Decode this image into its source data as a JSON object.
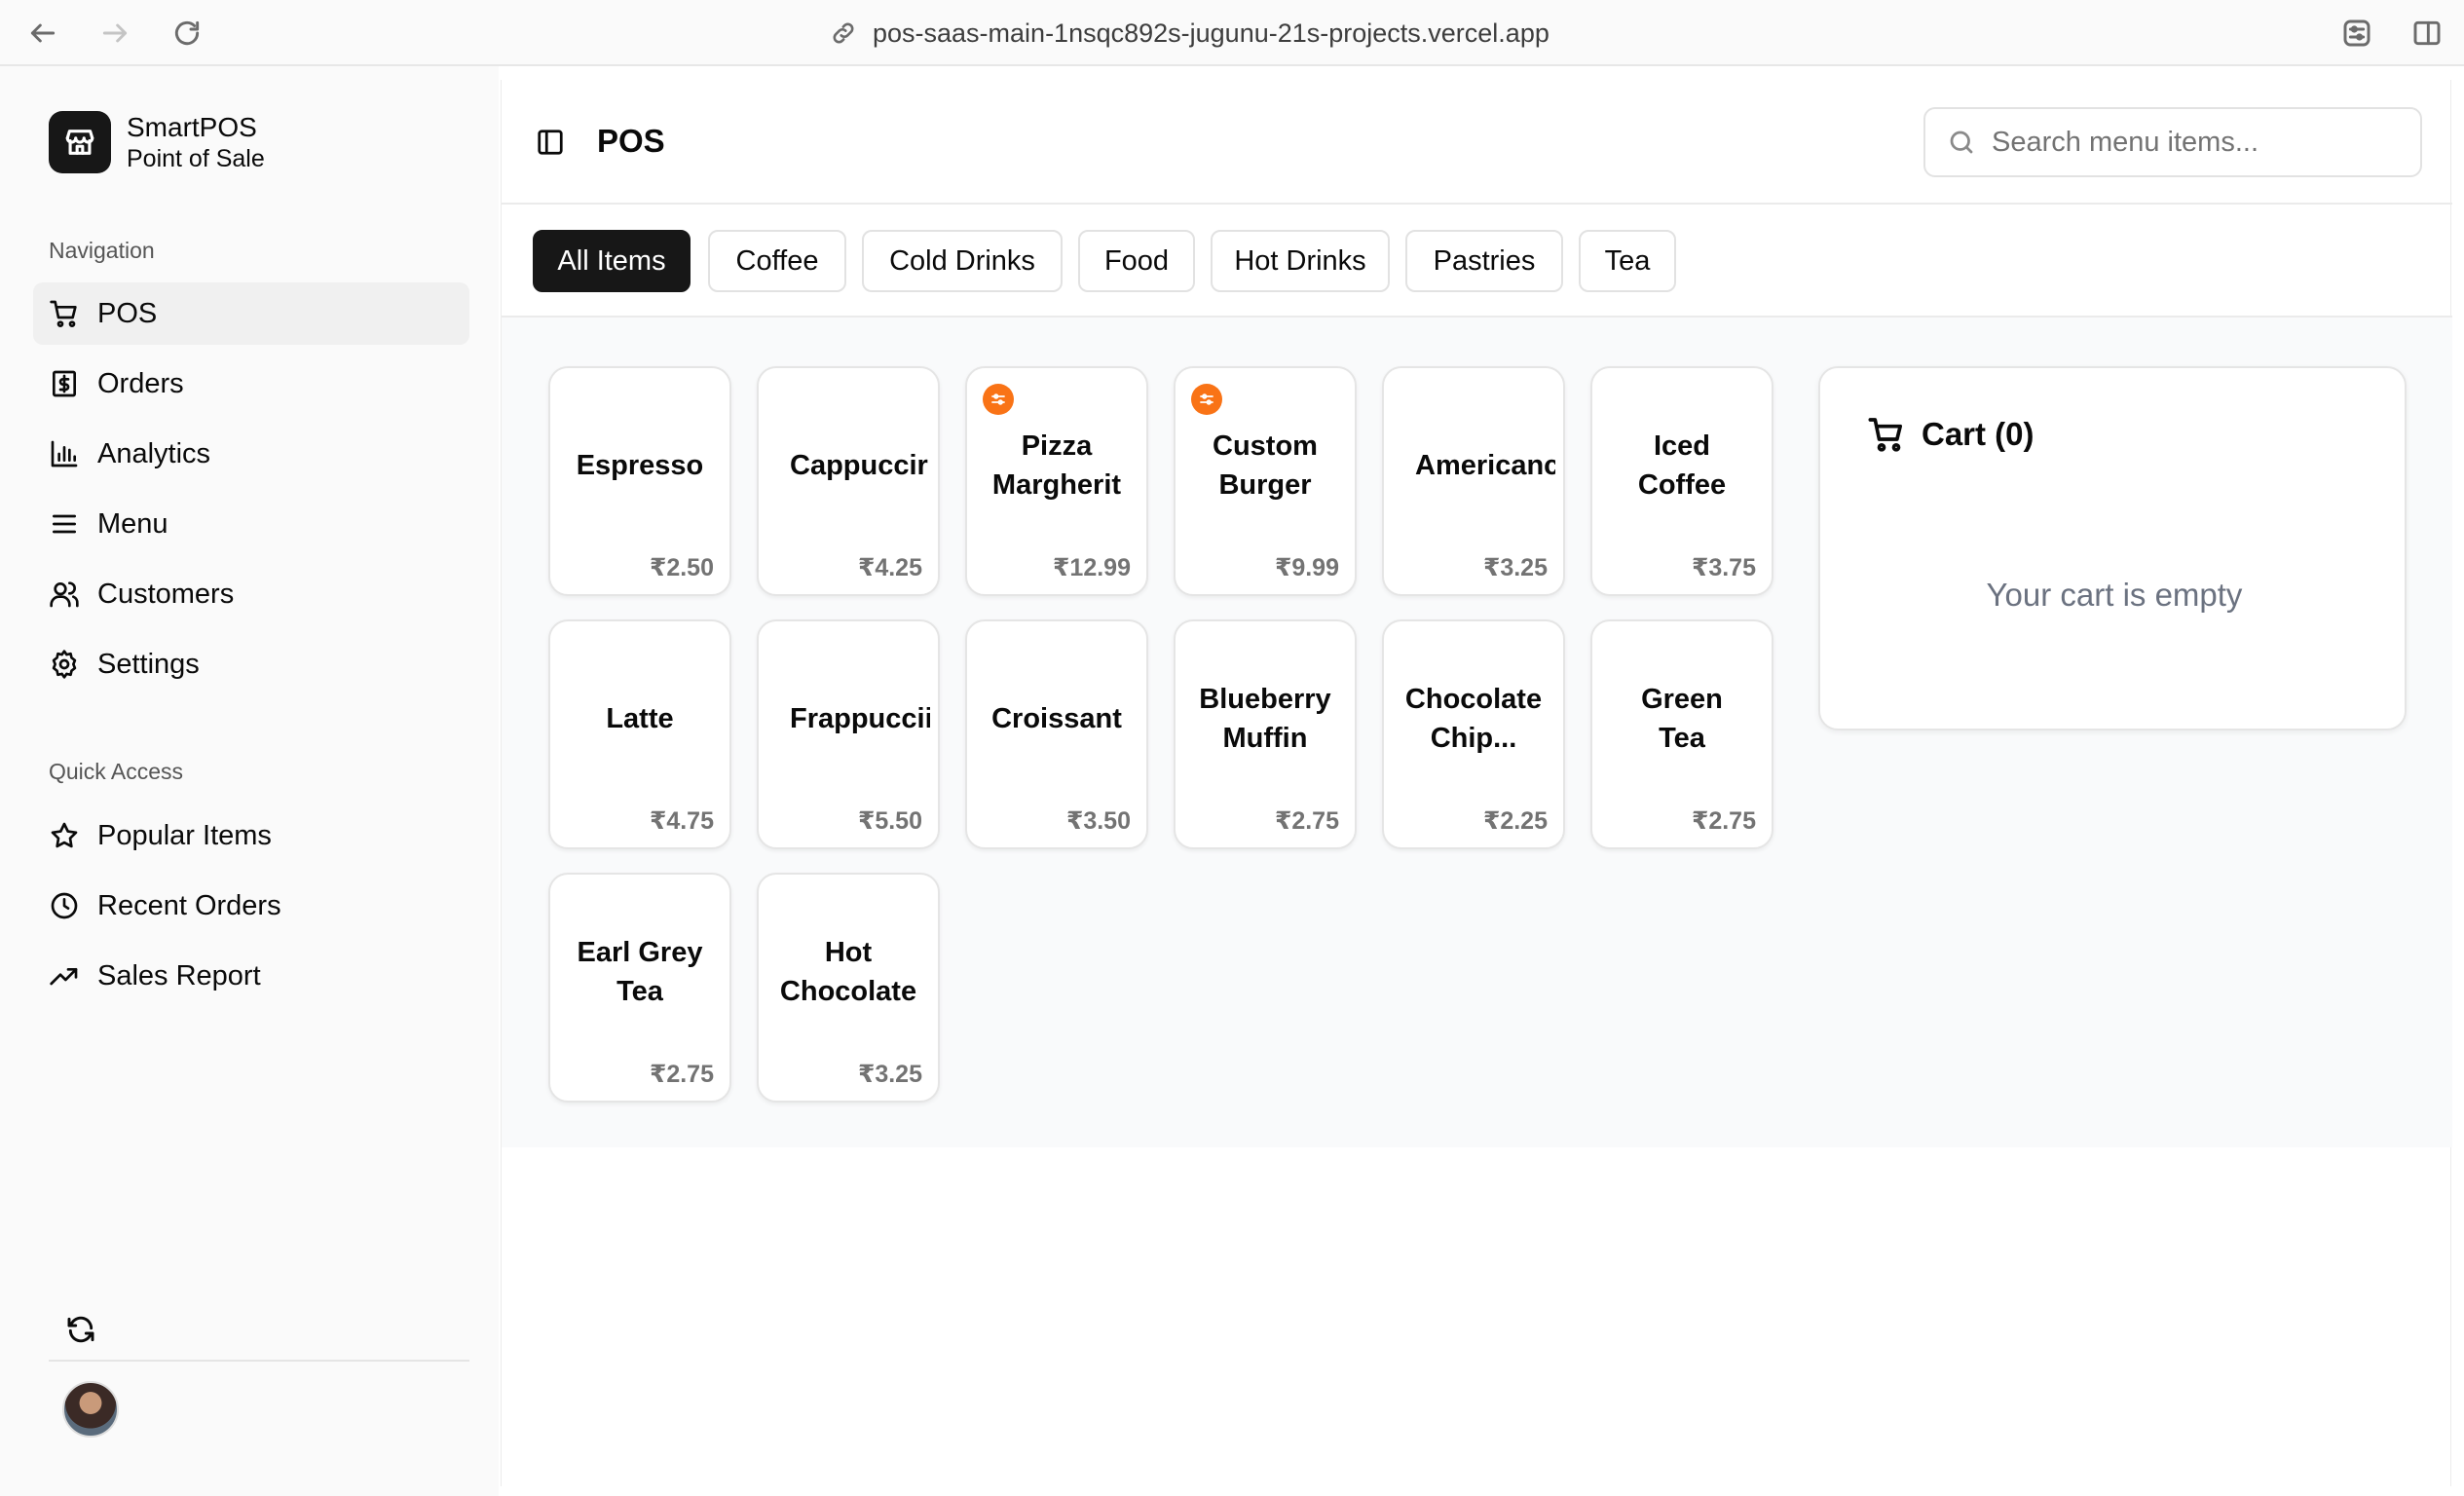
{
  "browser": {
    "url": "pos-saas-main-1nsqc892s-jugunu-21s-projects.vercel.app"
  },
  "sidebar": {
    "brand_name": "SmartPOS",
    "brand_subtitle": "Point of Sale",
    "navigation_label": "Navigation",
    "nav_items": [
      {
        "label": "POS",
        "icon": "shopping-cart-icon",
        "active": true
      },
      {
        "label": "Orders",
        "icon": "receipt-icon"
      },
      {
        "label": "Analytics",
        "icon": "bar-chart-icon"
      },
      {
        "label": "Menu",
        "icon": "list-icon"
      },
      {
        "label": "Customers",
        "icon": "users-icon"
      },
      {
        "label": "Settings",
        "icon": "gear-icon"
      }
    ],
    "quick_access_label": "Quick Access",
    "quick_items": [
      {
        "label": "Popular Items",
        "icon": "star-icon"
      },
      {
        "label": "Recent Orders",
        "icon": "clock-icon"
      },
      {
        "label": "Sales Report",
        "icon": "trending-up-icon"
      }
    ]
  },
  "header": {
    "title": "POS",
    "search_placeholder": "Search menu items..."
  },
  "categories": [
    "All Items",
    "Coffee",
    "Cold Drinks",
    "Food",
    "Hot Drinks",
    "Pastries",
    "Tea"
  ],
  "active_category": "All Items",
  "products": [
    {
      "name": "Espresso",
      "price": "₹2.50"
    },
    {
      "name": "Cappuccir",
      "price": "₹4.25"
    },
    {
      "name": "Pizza\nMargherit",
      "price": "₹12.99",
      "customizable": true
    },
    {
      "name": "Custom\nBurger",
      "price": "₹9.99",
      "customizable": true
    },
    {
      "name": "Americanc",
      "price": "₹3.25"
    },
    {
      "name": "Iced\nCoffee",
      "price": "₹3.75"
    },
    {
      "name": "Latte",
      "price": "₹4.75"
    },
    {
      "name": "Frappuccii",
      "price": "₹5.50"
    },
    {
      "name": "Croissant",
      "price": "₹3.50"
    },
    {
      "name": "Blueberry\nMuffin",
      "price": "₹2.75"
    },
    {
      "name": "Chocolate\nChip...",
      "price": "₹2.25"
    },
    {
      "name": "Green\nTea",
      "price": "₹2.75"
    },
    {
      "name": "Earl Grey\nTea",
      "price": "₹2.75"
    },
    {
      "name": "Hot\nChocolate",
      "price": "₹3.25"
    }
  ],
  "cart": {
    "title": "Cart (0)",
    "empty_message": "Your cart is empty"
  },
  "colors": {
    "accent_dark": "#171717",
    "badge_orange": "#f97316",
    "content_bg": "#f9fafb"
  }
}
